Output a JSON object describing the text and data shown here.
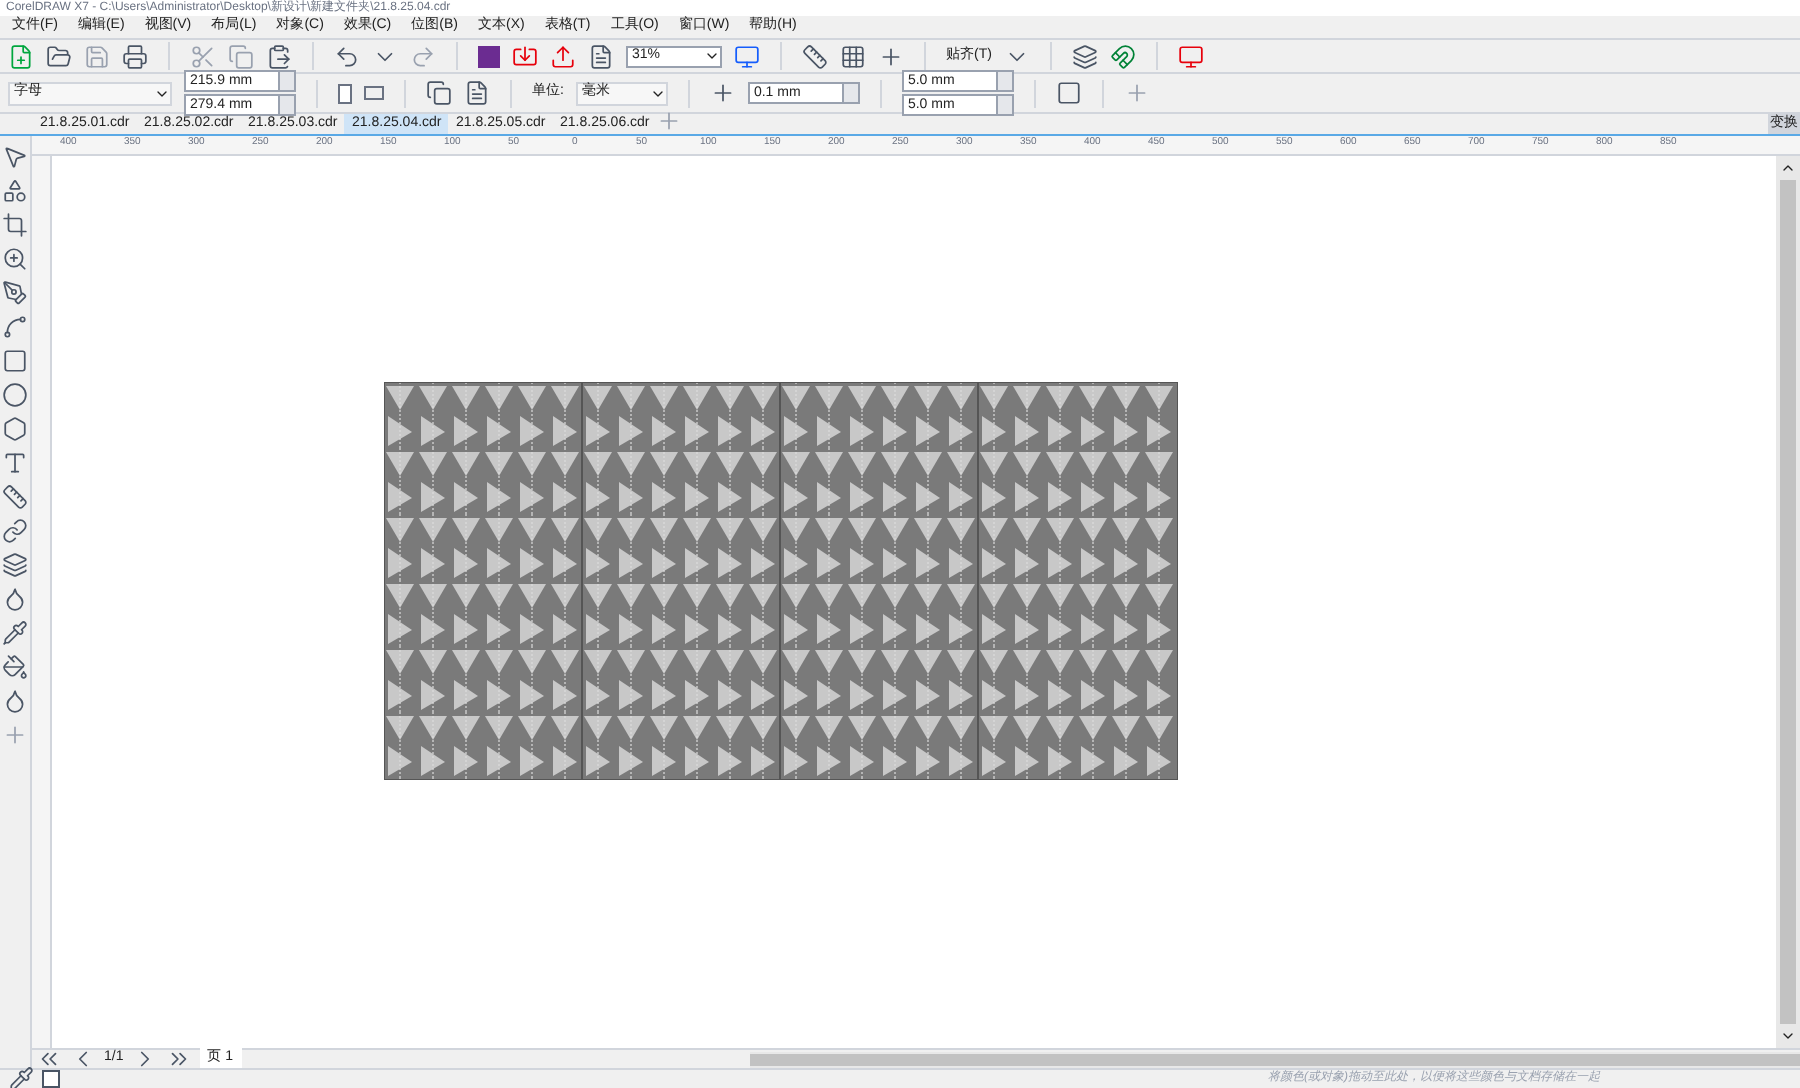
{
  "window": {
    "title": "CorelDRAW X7 - C:\\Users\\Administrator\\Desktop\\新设计\\新建文件夹\\21.8.25.04.cdr"
  },
  "menu": [
    "文件(F)",
    "编辑(E)",
    "视图(V)",
    "布局(L)",
    "对象(C)",
    "效果(C)",
    "位图(B)",
    "文本(X)",
    "表格(T)",
    "工具(O)",
    "窗口(W)",
    "帮助(H)"
  ],
  "toolbar": {
    "zoom": "31%",
    "snap": "贴齐(T)"
  },
  "property_bar": {
    "preset": "字母",
    "width": "215.9 mm",
    "height": "279.4 mm",
    "units_label": "单位:",
    "units": "毫米",
    "nudge": "0.1 mm",
    "dup_x": "5.0 mm",
    "dup_y": "5.0 mm"
  },
  "tabs": [
    {
      "label": "21.8.25.01.cdr",
      "selected": false
    },
    {
      "label": "21.8.25.02.cdr",
      "selected": false
    },
    {
      "label": "21.8.25.03.cdr",
      "selected": false
    },
    {
      "label": "21.8.25.04.cdr",
      "selected": true
    },
    {
      "label": "21.8.25.05.cdr",
      "selected": false
    },
    {
      "label": "21.8.25.06.cdr",
      "selected": false
    }
  ],
  "ruler_h": [
    "400",
    "350",
    "300",
    "250",
    "200",
    "150",
    "100",
    "50",
    "0",
    "50",
    "100",
    "150",
    "200",
    "250",
    "300",
    "350",
    "400",
    "450",
    "500",
    "550",
    "600",
    "650",
    "700",
    "750",
    "800",
    "850"
  ],
  "right_panel": {
    "label": "变换"
  },
  "page_nav": {
    "count": "1/1",
    "page": "页 1"
  },
  "status_bar": {
    "text": "将颜色(或对象)拖动至此处，以便将这些颜色与文档存储在一起"
  }
}
